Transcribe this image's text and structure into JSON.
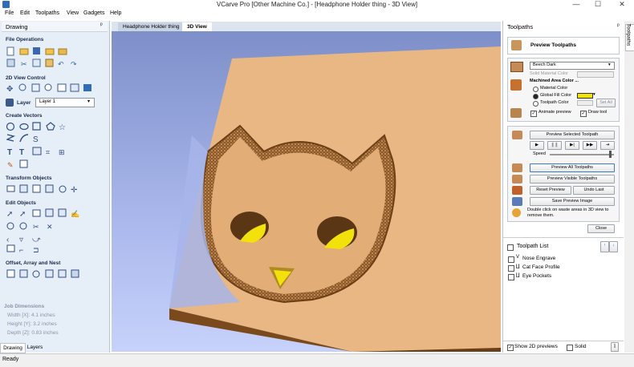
{
  "window": {
    "title": "VCarve Pro [Other Machine Co.] - [Headphone Holder thing - 3D View]",
    "min": "—",
    "max": "☐",
    "close": "✕"
  },
  "menu": [
    "File",
    "Edit",
    "Toolpaths",
    "View",
    "Gadgets",
    "Help"
  ],
  "left": {
    "header": "Drawing",
    "pin": "ᵖ",
    "sections": {
      "file_ops": "File Operations",
      "view_control": "2D View Control",
      "layer_label": "Layer",
      "layer_value": "Layer 1",
      "create_vectors": "Create Vectors",
      "transform": "Transform Objects",
      "edit": "Edit Objects",
      "offset": "Offset, Array and Nest"
    },
    "job": {
      "title": "Job Dimensions",
      "width": "Width  [X]: 4.1 inches",
      "height": "Height [Y]: 3.2 inches",
      "depth": "Depth  [Z]: 0.83 inches"
    },
    "bottom_tabs": [
      "Drawing",
      "Layers"
    ]
  },
  "doc_tabs": [
    "Headphone Holder thing",
    "3D View"
  ],
  "right": {
    "header": "Toolpaths",
    "pin": "ᵖ",
    "preview_title": "Preview Toolpaths",
    "material": "Beech Dark",
    "solid_material_color": "Solid Material Color",
    "machined_area_color": "Machined Area Color ...",
    "material_color": "Material Color",
    "global_fill_color": "Global Fill Color",
    "toolpath_color": "Toolpath Color",
    "set_all": "Set All",
    "animate_preview": "Animate preview",
    "draw_tool": "Draw tool",
    "preview_selected": "Preview Selected Toolpath",
    "speed": "Speed",
    "preview_all": "Preview All Toolpaths",
    "preview_visible": "Preview Visible Toolpaths",
    "reset_preview": "Reset Preview",
    "undo_last": "Undo Last",
    "save_preview_image": "Save Preview Image",
    "waste_note": "Double click on waste areas in 3D view to remove them.",
    "close": "Close",
    "toolpath_list_title": "Toolpath List",
    "toolpaths": [
      "Nose Engrave",
      "Cat Face Profile",
      "Eye Pockets"
    ],
    "show_2d_previews": "Show 2D previews",
    "solid": "Solid",
    "side_tab": "Toolpaths"
  },
  "status": "Ready",
  "colors": {
    "panel": "#e6eef8",
    "accent": "#2f6db5",
    "wood": "#e9b985",
    "wood_dark": "#7a4a1d",
    "fill": "#f2e10a"
  }
}
